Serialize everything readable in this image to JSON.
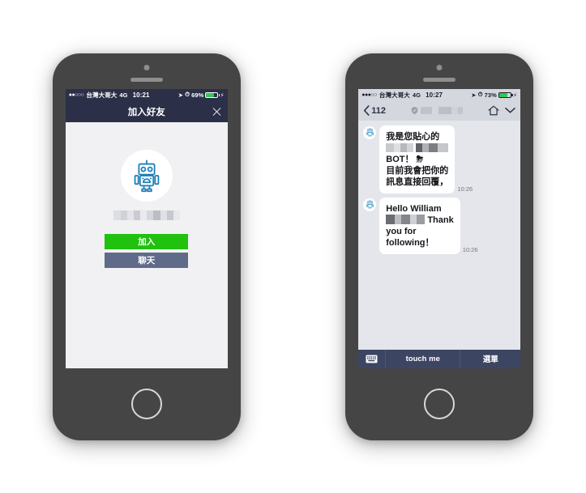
{
  "theme": {
    "navy": "#2b3048",
    "green": "#21c10f",
    "slate": "#606b8a",
    "footer_navy": "#3c4663",
    "screen_bg": "#f1f1f4",
    "chat_bg": "#e4e6eb",
    "header_gray": "#d4d7dd",
    "robot_blue": "#1d7fb5"
  },
  "left_phone": {
    "status_bar": {
      "signal_dots": "●●○○○",
      "carrier": "台灣大哥大",
      "network": "4G",
      "time": "10:21",
      "location_icon": "location-arrow-icon",
      "alarm_icon": "alarm-icon",
      "battery_text": "69%",
      "battery_level": 69,
      "charging_icon": "bolt-icon"
    },
    "navbar": {
      "title": "加入好友",
      "close_icon": "close-icon"
    },
    "profile": {
      "avatar_icon": "robot-avatar-icon",
      "name_redacted": "",
      "buttons": [
        {
          "label": "加入",
          "style": "join"
        },
        {
          "label": "聊天",
          "style": "chat"
        }
      ]
    }
  },
  "right_phone": {
    "status_bar": {
      "signal_dots": "●●●○○",
      "carrier": "台灣大哥大",
      "network": "4G",
      "time": "10:27",
      "location_icon": "location-arrow-icon",
      "alarm_icon": "alarm-icon",
      "battery_text": "73%",
      "battery_level": 73,
      "charging_icon": "bolt-icon"
    },
    "chat_header": {
      "back_icon": "chevron-left-icon",
      "back_label": "112",
      "shield_icon": "shield-icon",
      "title_redacted": "",
      "home_icon": "home-icon",
      "chevron_down_icon": "chevron-down-icon"
    },
    "messages": [
      {
        "sender_avatar": "robot-avatar-icon",
        "line1": "我是您貼心的",
        "line2_redacted": "",
        "line3": "BOT！",
        "line3_emoji": "⛈",
        "line4": "目前我會把你的",
        "line5": "訊息直接回覆，",
        "redacted_block_count": 5,
        "time": "10:26"
      },
      {
        "sender_avatar": "robot-avatar-icon",
        "line1": "Hello William",
        "line2_redacted": "",
        "line2_after": "Thank",
        "line3": "you for",
        "line4": "following！",
        "time": "10:26"
      }
    ],
    "footer": {
      "keyboard_icon": "keyboard-icon",
      "touch_label": "touch me",
      "menu_label": "選單"
    }
  }
}
